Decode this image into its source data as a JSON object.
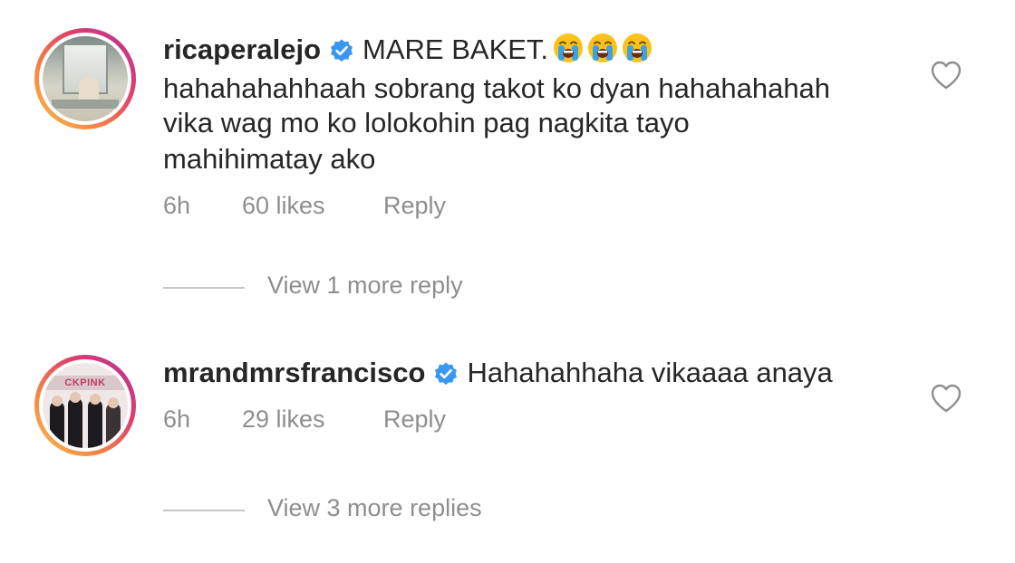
{
  "comments": [
    {
      "username": "ricaperalejo",
      "verified": true,
      "text_lines": [
        "MARE BAKET.",
        "hahahahahhaah sobrang takot ko dyan hahahahahah",
        "vika wag mo ko lolokohin pag nagkita tayo",
        "mahihimatay ako"
      ],
      "emojis": [
        "😭",
        "😭",
        "😭"
      ],
      "time": "6h",
      "likes": "60 likes",
      "reply_label": "Reply",
      "view_replies": "View 1 more reply",
      "avatar": "photo-of-person-by-window",
      "like_icon": "heart-outline-icon"
    },
    {
      "username": "mrandmrsfrancisco",
      "verified": true,
      "text_lines": [
        "Hahahahhaha vikaaaa anaya"
      ],
      "time": "6h",
      "likes": "29 likes",
      "reply_label": "Reply",
      "view_replies": "View 3 more replies",
      "avatar_banner": "CKPINK",
      "avatar": "photo-of-four-performers",
      "like_icon": "heart-outline-icon"
    }
  ],
  "colors": {
    "text": "#262626",
    "secondary": "#8e8e8e",
    "verified_blue": "#3897f0",
    "divider": "#c7c7c7",
    "story_ring_start": "#f9c251",
    "story_ring_end": "#b32e9a"
  }
}
